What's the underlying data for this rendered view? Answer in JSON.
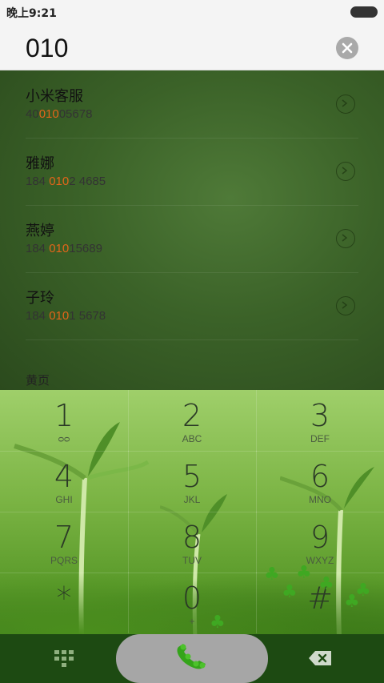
{
  "status": {
    "time": "晚上9:21"
  },
  "search": {
    "query": "010"
  },
  "contacts": [
    {
      "name": "小米客服",
      "num_pre": "40",
      "num_hl": "010",
      "num_post": "05678"
    },
    {
      "name": "雅娜",
      "num_pre": "184 ",
      "num_hl": "010",
      "num_post": "2 4685"
    },
    {
      "name": "燕婷",
      "num_pre": "184 ",
      "num_hl": "010",
      "num_post": "15689"
    },
    {
      "name": "子玲",
      "num_pre": "184 ",
      "num_hl": "010",
      "num_post": "1 5678"
    }
  ],
  "section": {
    "yellow_pages": "黄页"
  },
  "keys": [
    {
      "digit": "1",
      "letters": "ᴑᴑ"
    },
    {
      "digit": "2",
      "letters": "ABC"
    },
    {
      "digit": "3",
      "letters": "DEF"
    },
    {
      "digit": "4",
      "letters": "GHI"
    },
    {
      "digit": "5",
      "letters": "JKL"
    },
    {
      "digit": "6",
      "letters": "MNO"
    },
    {
      "digit": "7",
      "letters": "PQRS"
    },
    {
      "digit": "8",
      "letters": "TUV"
    },
    {
      "digit": "9",
      "letters": "WXYZ"
    },
    {
      "digit": "*",
      "letters": ""
    },
    {
      "digit": "0",
      "letters": "+"
    },
    {
      "digit": "#",
      "letters": ""
    }
  ],
  "colors": {
    "highlight": "#e2651a",
    "bottom_bar": "#1d4a12",
    "call_button": "#a6a6a6"
  },
  "icons": {
    "clear": "close-icon",
    "detail": "chevron-right-icon",
    "dialpad": "dialpad-icon",
    "call": "phone-icon",
    "backspace": "backspace-icon"
  }
}
